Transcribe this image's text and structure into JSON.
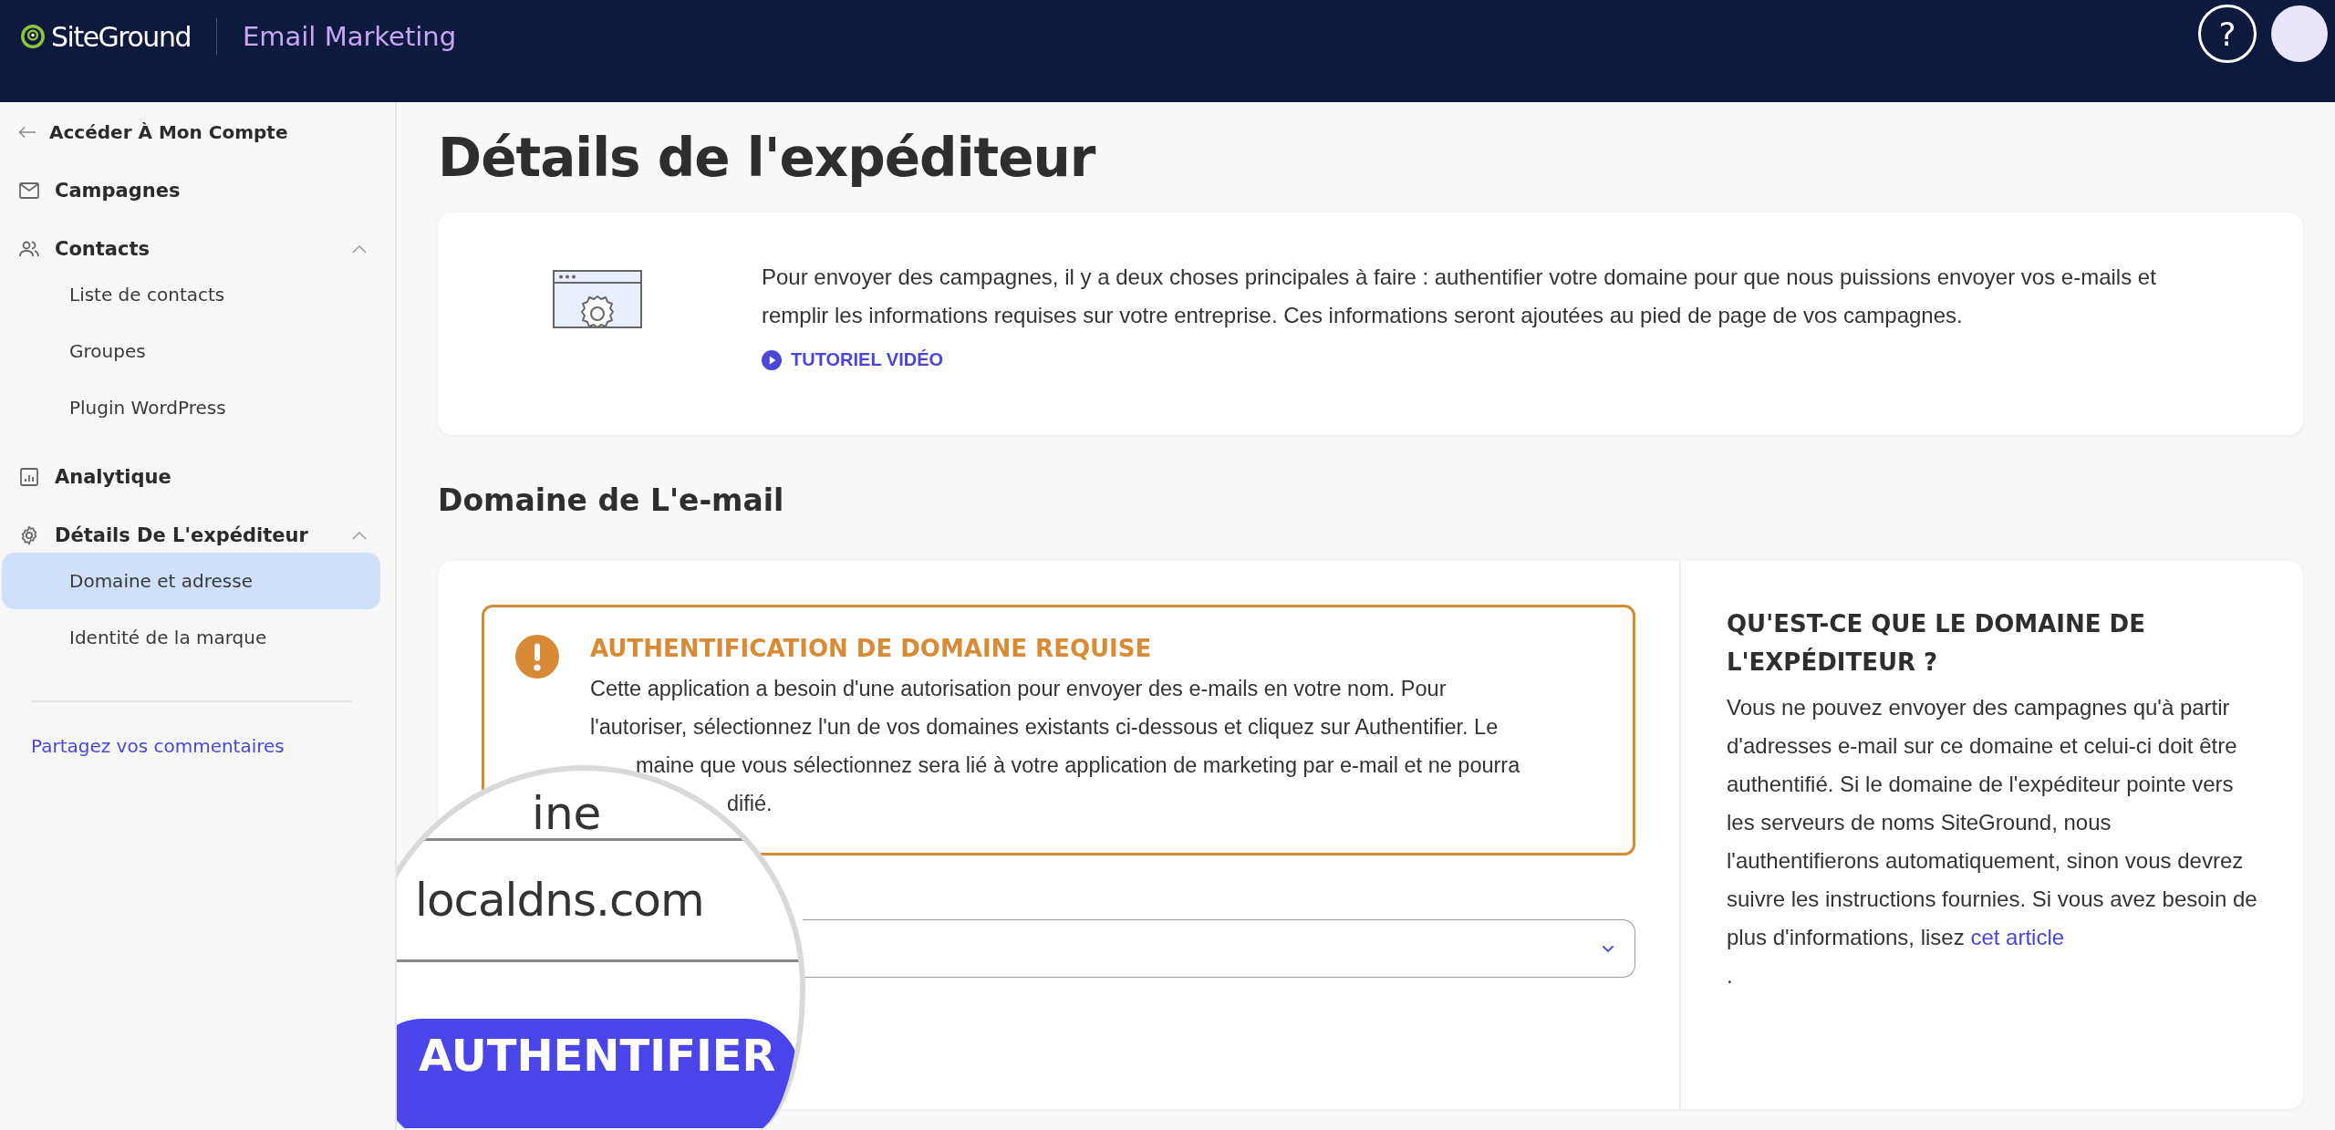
{
  "header": {
    "logo": "SiteGround",
    "app_title": "Email Marketing",
    "help": "?"
  },
  "sidebar": {
    "back_link": "Accéder À Mon Compte",
    "items": [
      {
        "kind": "link",
        "label": "Campagnes"
      },
      {
        "kind": "group",
        "label": "Contacts",
        "expanded": true,
        "children": [
          {
            "label": "Liste de contacts",
            "selected": false
          },
          {
            "label": "Groupes",
            "selected": false
          },
          {
            "label": "Plugin WordPress",
            "selected": false
          }
        ]
      },
      {
        "kind": "link",
        "label": "Analytique"
      },
      {
        "kind": "group",
        "label": "Détails De L'expéditeur",
        "expanded": true,
        "children": [
          {
            "label": "Domaine et adresse",
            "selected": true
          },
          {
            "label": "Identité de la marque",
            "selected": false
          }
        ]
      }
    ],
    "feedback_link": "Partagez vos commentaires"
  },
  "page_title": "Détails de l'expéditeur",
  "intro_card": {
    "text": "Pour envoyer des campagnes, il y a deux choses principales à faire : authentifier votre domaine pour que nous puissions envoyer vos e-mails et remplir les informations requises sur votre entreprise. Ces informations seront ajoutées au pied de page de vos campagnes.",
    "video_link": "TUTORIEL VIDÉO"
  },
  "section_title": "Domaine de L'e-mail",
  "domain_card": {
    "alert": {
      "title": "AUTHENTIFICATION DE DOMAINE REQUISE",
      "lines": [
        "Cette application a besoin d'une autorisation pour envoyer des e-mails en votre nom. Pour",
        "l'autoriser, sélectionnez l'un de vos domaines existants ci-dessous et cliquez sur Authentifier. Le",
        "maine que vous sélectionnez sera lié à votre application de marketing par e-mail et ne pourra",
        "difié."
      ]
    },
    "magnifier": {
      "label_fragment": "ine",
      "value": "localdns.com",
      "button": "AUTHENTIFIER"
    },
    "help": {
      "title": "QU'EST-CE QUE LE DOMAINE DE L'EXPÉDITEUR ?",
      "text": "Vous ne pouvez envoyer des campagnes qu'à partir d'adresses e-mail sur ce domaine et celui-ci doit être authentifié. Si le domaine de l'expéditeur pointe vers les serveurs de noms SiteGround, nous l'authentifierons automatiquement, sinon vous devrez suivre les instructions fournies. Si vous avez besoin de plus d'informations, lisez ",
      "link": "cet article",
      "after": "."
    }
  }
}
